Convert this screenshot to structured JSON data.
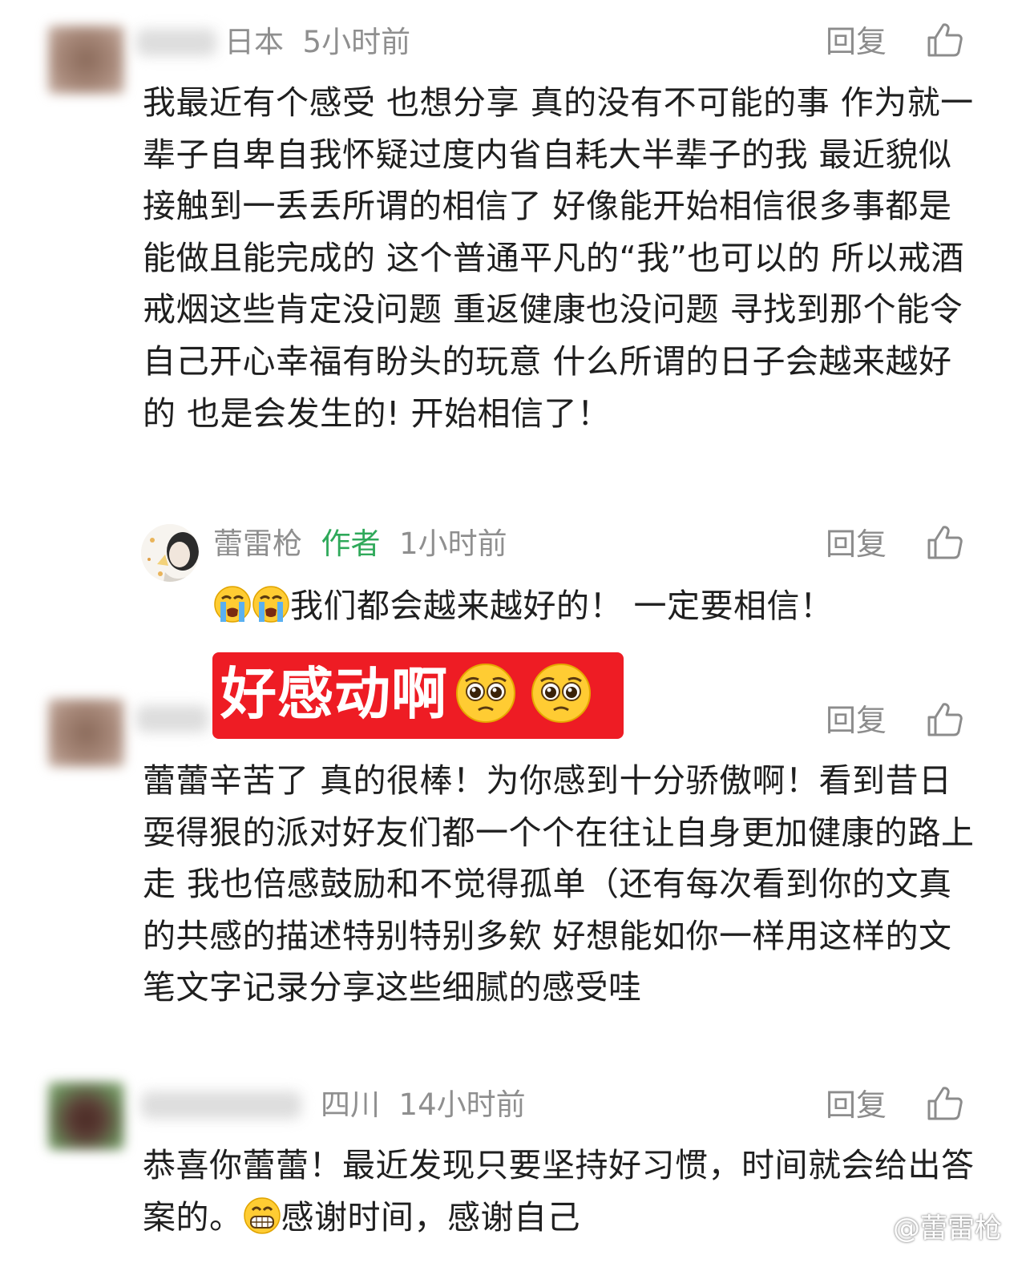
{
  "actions": {
    "reply_label": "回复"
  },
  "comments": [
    {
      "location": "日本",
      "time": "5小时前",
      "text": "我最近有个感受 也想分享 真的没有不可能的事 作为就一辈子自卑自我怀疑过度内省自耗大半辈子的我 最近貌似接触到一丢丢所谓的相信了 好像能开始相信很多事都是能做且能完成的 这个普通平凡的“我”也可以的 所以戒酒戒烟这些肯定没问题 重返健康也没问题 寻找到那个能令自己开心幸福有盼头的玩意 什么所谓的日子会越来越好的 也是会发生的! 开始相信了！"
    },
    {
      "text": "蕾蕾辛苦了 真的很棒！为你感到十分骄傲啊！看到昔日耍得狠的派对好友们都一个个在往让自身更加健康的路上走 我也倍感鼓励和不觉得孤单（还有每次看到你的文真的共感的描述特别特别多欸 好想能如你一样用这样的文笔文字记录分享这些细腻的感受哇"
    },
    {
      "location": "四川",
      "time": "14小时前",
      "text_before_emoji": "恭喜你蕾蕾！最近发现只要坚持好习惯，时间就会给出答案的。",
      "emoji": "grinning-face-emoji",
      "text_after_emoji": "感谢时间，感谢自己"
    }
  ],
  "author_reply": {
    "author_name": "蕾雷枪",
    "author_tag": "作者",
    "time": "1小时前",
    "emojis": [
      "loudly-crying-face-emoji",
      "loudly-crying-face-emoji"
    ],
    "text": "我们都会越来越好的！ 一定要相信！"
  },
  "banner": {
    "text": "好感动啊",
    "emojis": [
      "pleading-face-emoji",
      "pleading-face-emoji"
    ],
    "background": "#ee1c24"
  },
  "watermark": {
    "text": "@蕾雷枪",
    "icon": "weibo-logo-icon"
  },
  "colors": {
    "meta": "#8f8f8f",
    "author_tag": "#2fa95a",
    "body_text": "#1f1f1f"
  }
}
